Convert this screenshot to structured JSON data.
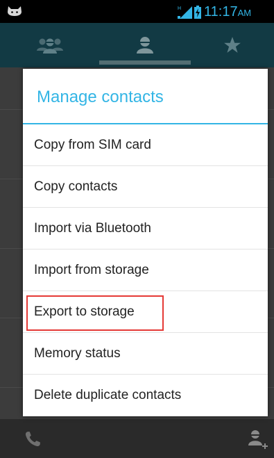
{
  "status_bar": {
    "time": "11:17",
    "ampm": "AM",
    "icons": [
      "android-cat-icon",
      "signal-icon",
      "battery-charging-icon"
    ]
  },
  "tabs": [
    {
      "name": "groups",
      "icon": "group-icon"
    },
    {
      "name": "contacts",
      "icon": "person-icon",
      "selected": true
    },
    {
      "name": "favorites",
      "icon": "star-icon"
    }
  ],
  "dialog": {
    "title": "Manage contacts",
    "items": [
      {
        "label": "Copy from SIM card"
      },
      {
        "label": "Copy contacts"
      },
      {
        "label": "Import via Bluetooth"
      },
      {
        "label": "Import from storage"
      },
      {
        "label": "Export to storage",
        "highlighted": true
      },
      {
        "label": "Memory status"
      },
      {
        "label": "Delete duplicate contacts"
      }
    ]
  },
  "bottom_bar": {
    "icons": [
      "phone-icon",
      "add-contact-icon"
    ]
  },
  "colors": {
    "accent": "#33b5e5",
    "tab_bar": "#123a44",
    "highlight": "#e53935"
  }
}
